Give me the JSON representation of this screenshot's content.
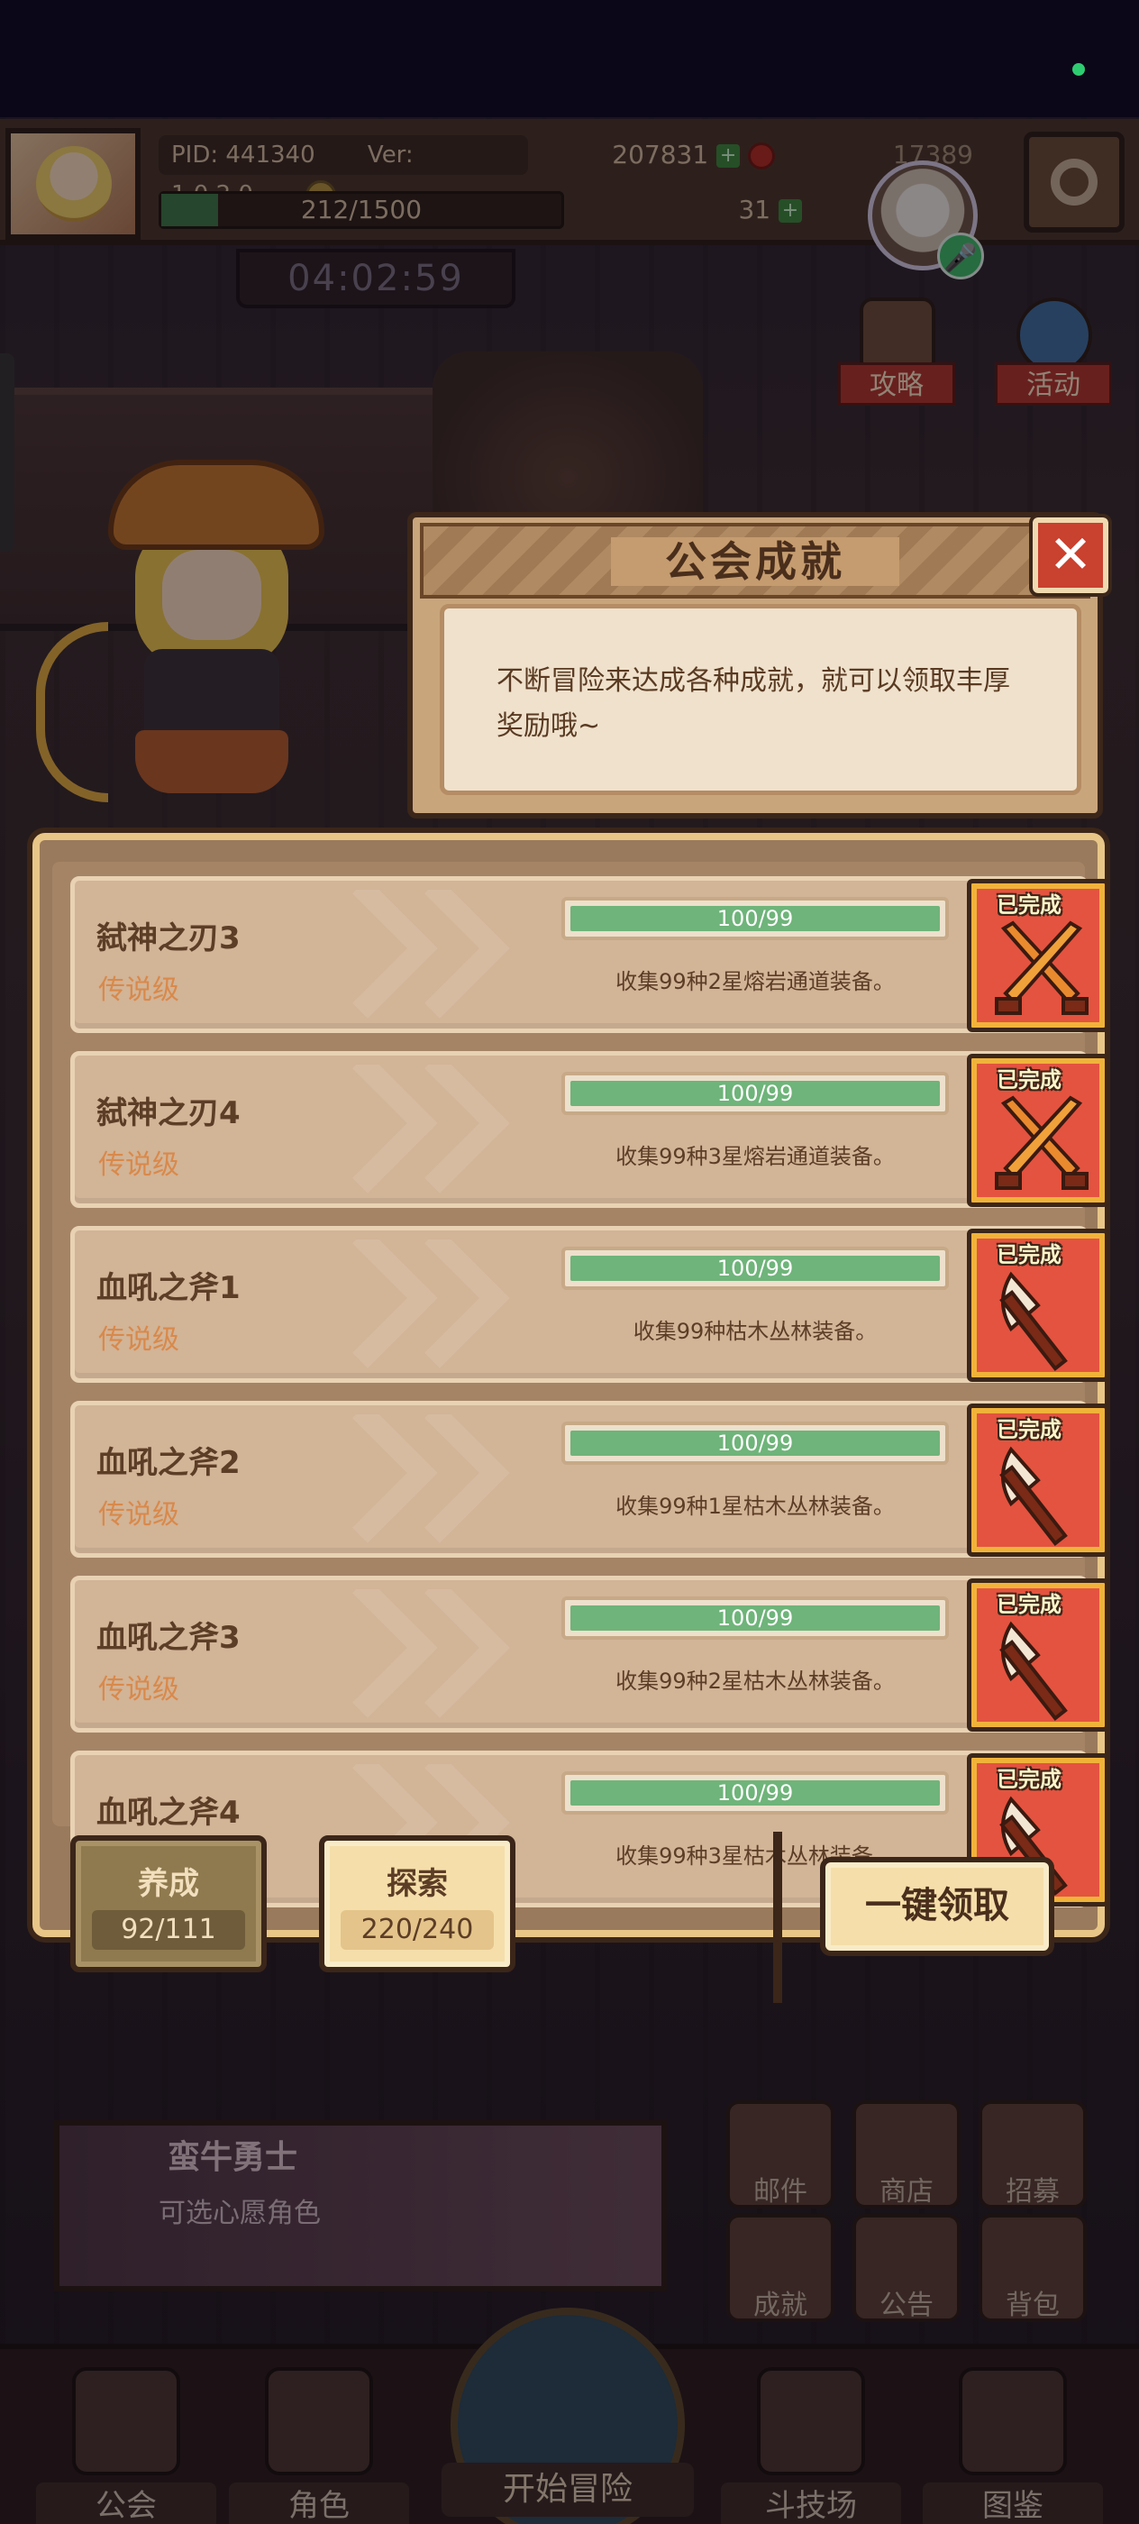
{
  "hud": {
    "pid": "PID: 441340",
    "version": "Ver: 1.0.2.0",
    "gold": "207831",
    "gems": "17389",
    "energy": "212/1500",
    "energy_fraction": 0.141,
    "extra_count": "31",
    "timer": "04:02:59"
  },
  "side_buttons": {
    "guide": "攻略",
    "event": "活动"
  },
  "dialog": {
    "title": "公会成就",
    "description": "不断冒险来达成各种成就，就可以领取丰厚奖励哦~",
    "close_label": "✕"
  },
  "achievements": [
    {
      "name": "弑神之刃3",
      "tier": "传说级",
      "progress": "100/99",
      "progress_fraction": 1.0,
      "desc": "收集99种2星熔岩通道装备。",
      "status": "已完成",
      "icon": "crossed-swords-icon"
    },
    {
      "name": "弑神之刃4",
      "tier": "传说级",
      "progress": "100/99",
      "progress_fraction": 1.0,
      "desc": "收集99种3星熔岩通道装备。",
      "status": "已完成",
      "icon": "crossed-swords-icon"
    },
    {
      "name": "血吼之斧1",
      "tier": "传说级",
      "progress": "100/99",
      "progress_fraction": 1.0,
      "desc": "收集99种枯木丛林装备。",
      "status": "已完成",
      "icon": "axe-icon"
    },
    {
      "name": "血吼之斧2",
      "tier": "传说级",
      "progress": "100/99",
      "progress_fraction": 1.0,
      "desc": "收集99种1星枯木丛林装备。",
      "status": "已完成",
      "icon": "axe-icon"
    },
    {
      "name": "血吼之斧3",
      "tier": "传说级",
      "progress": "100/99",
      "progress_fraction": 1.0,
      "desc": "收集99种2星枯木丛林装备。",
      "status": "已完成",
      "icon": "axe-icon"
    },
    {
      "name": "血吼之斧4",
      "tier": "传说级",
      "progress": "100/99",
      "progress_fraction": 1.0,
      "desc": "收集99种3星枯木丛林装备。",
      "status": "已完成",
      "icon": "axe-icon"
    }
  ],
  "tabs": {
    "nurture": {
      "label": "养成",
      "count": "92/111"
    },
    "explore": {
      "label": "探索",
      "count": "220/240"
    }
  },
  "claim_all": "一键领取",
  "right_grid": [
    "邮件",
    "商店",
    "招募",
    "成就",
    "公告",
    "背包"
  ],
  "banner": {
    "title": "蛮牛勇士",
    "subtitle": "可选心愿角色"
  },
  "nav": {
    "guild": "公会",
    "character": "角色",
    "start": "开始冒险",
    "arena": "斗技场",
    "codex": "图鉴"
  },
  "colors": {
    "progress_fill": "#6fb47a",
    "icon_bg": "#e4533f",
    "tier_text": "#d9894a"
  }
}
